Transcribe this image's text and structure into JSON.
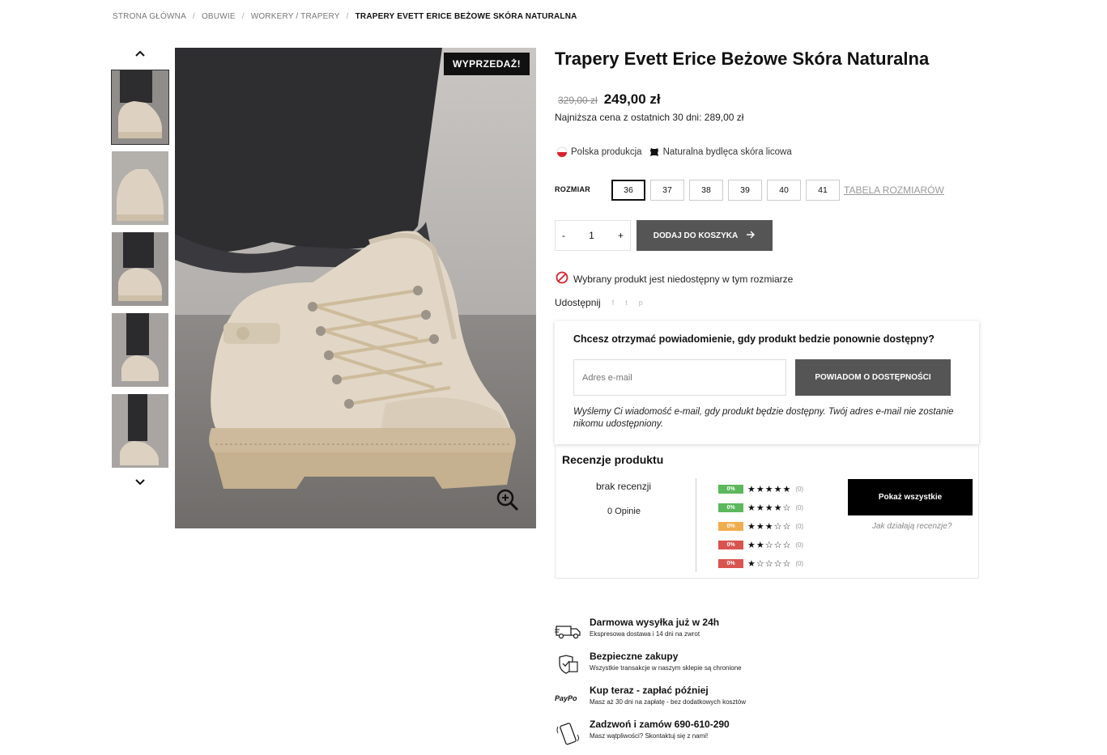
{
  "breadcrumb": {
    "items": [
      "STRONA GŁÓWNA",
      "OBUWIE",
      "WORKERY / TRAPERY"
    ],
    "current": "TRAPERY EVETT ERICE BEŻOWE SKÓRA NATURALNA",
    "separator": "/"
  },
  "gallery": {
    "up_icon": "chevron-up-icon",
    "down_icon": "chevron-down-icon",
    "sale_badge": "WYPRZEDAŻ!",
    "zoom_icon": "zoom-in-icon"
  },
  "product": {
    "title": "Trapery Evett Erice Beżowe Skóra Naturalna",
    "old_price": "329,00 zł",
    "new_price": "249,00 zł",
    "lowest_price": "Najniższa cena z ostatnich 30 dni: 289,00 zł",
    "badge_polish": "Polska produkcja",
    "badge_leather": "Naturalna bydlęca skóra licowa"
  },
  "size": {
    "label": "ROZMIAR",
    "options": [
      "36",
      "37",
      "38",
      "39",
      "40",
      "41"
    ],
    "selected": "36",
    "table_link": "TABELA ROZMIARÓW"
  },
  "cart": {
    "minus": "-",
    "quantity": "1",
    "plus": "+",
    "add_label": "DODAJ DO KOSZYKA"
  },
  "availability": "Wybrany produkt jest niedostępny w tym rozmiarze",
  "share": {
    "label": "Udostępnij",
    "facebook": "f",
    "twitter": "t",
    "pinterest": "p"
  },
  "notify": {
    "question": "Chcesz otrzymać powiadomienie, gdy produkt bedzie ponownie dostępny?",
    "placeholder": "Adres e-mail",
    "button": "POWIADOM O DOSTĘPNOŚCI",
    "info": "Wyślemy Ci wiadomość e-mail, gdy produkt będzie dostępny. Twój adres e-mail nie zostanie nikomu udostępniony."
  },
  "reviews": {
    "title": "Recenzje produktu",
    "no_reviews": "brak recenzji",
    "opinions": "0 Opinie",
    "rows": [
      {
        "pct": "0%",
        "stars": "★★★★★",
        "count": "(0)",
        "color": "#5cb85c"
      },
      {
        "pct": "0%",
        "stars": "★★★★☆",
        "count": "(0)",
        "color": "#5cb85c"
      },
      {
        "pct": "0%",
        "stars": "★★★☆☆",
        "count": "(0)",
        "color": "#f0ad4e"
      },
      {
        "pct": "0%",
        "stars": "★★☆☆☆",
        "count": "(0)",
        "color": "#d9534f"
      },
      {
        "pct": "0%",
        "stars": "★☆☆☆☆",
        "count": "(0)",
        "color": "#d9534f"
      }
    ],
    "show_all": "Pokaż wszystkie",
    "how": "Jak działają recenzje?"
  },
  "features": [
    {
      "title": "Darmowa wysyłka już w 24h",
      "subtitle": "Ekspresowa dostawa i 14 dni na zwrot",
      "icon": "truck-icon"
    },
    {
      "title": "Bezpieczne zakupy",
      "subtitle": "Wszystkie transakcje w naszym sklepie są chronione",
      "icon": "secure-shield-icon"
    },
    {
      "title": "Kup teraz - zapłać później",
      "subtitle": "Masz aż 30 dni na zapłatę - bez dodatkowych kosztów",
      "icon": "paypo-icon",
      "icon_text": "PayPo"
    },
    {
      "title": "Zadzwoń i zamów 690-610-290",
      "subtitle": "Masz wątpliwości? Skontaktuj się z nami!",
      "icon": "phone-icon"
    }
  ],
  "colors": {
    "button_dark": "#555555",
    "black": "#000000",
    "unavailable_red": "#d9232d"
  }
}
